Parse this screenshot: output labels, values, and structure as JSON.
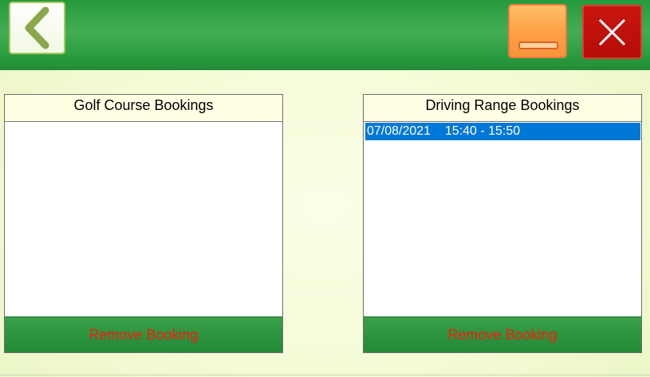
{
  "header": {
    "back_icon": "chevron-left-icon",
    "minimize_icon": "minimize-icon",
    "close_icon": "close-icon",
    "colors": {
      "bar": "#2a9c40",
      "minimize": "#ff9f45",
      "close": "#b60d08"
    }
  },
  "golf_course": {
    "title": "Golf Course Bookings",
    "items": [],
    "remove_label": "Remove Booking"
  },
  "driving_range": {
    "title": "Driving Range Bookings",
    "items": [
      {
        "text": "07/08/2021    15:40 - 15:50",
        "selected": true
      }
    ],
    "remove_label": "Remove Booking"
  },
  "colors": {
    "selection": "#0078d7",
    "remove_text": "#ff1a0a",
    "panel_header": "#ffffe4"
  }
}
